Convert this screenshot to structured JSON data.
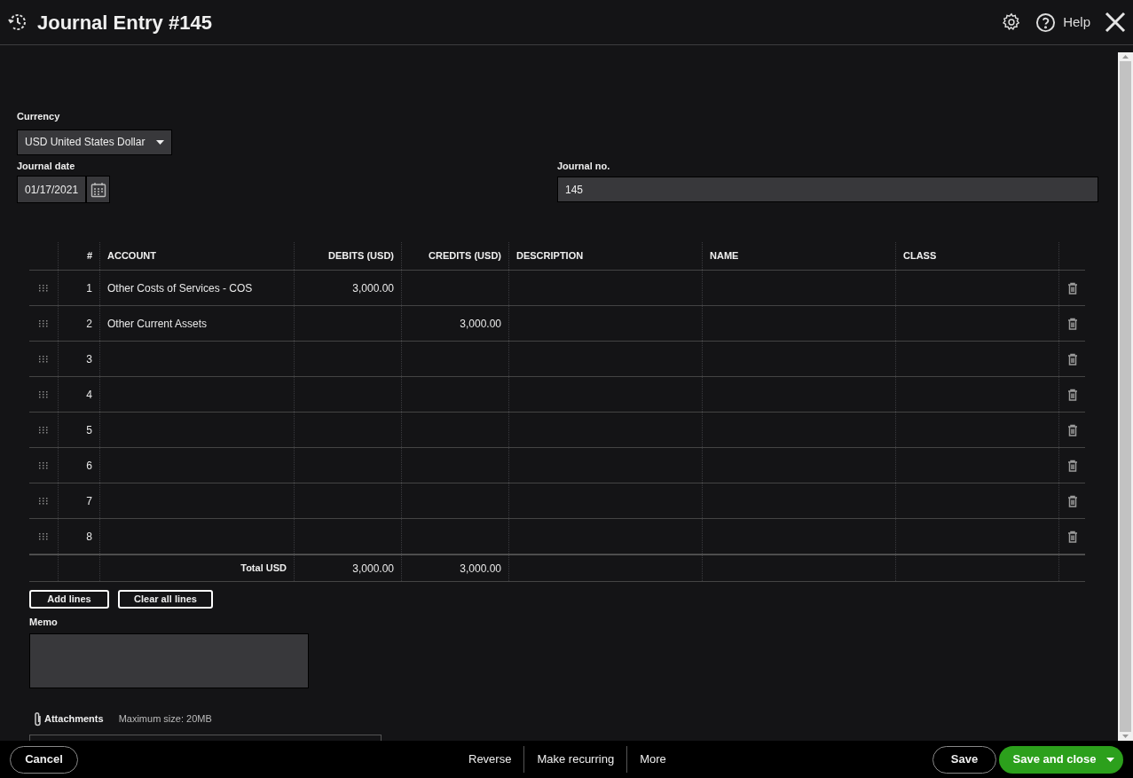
{
  "header": {
    "title": "Journal Entry #145",
    "help": "Help"
  },
  "currency": {
    "label": "Currency",
    "value": "USD United States Dollar"
  },
  "journal_date": {
    "label": "Journal date",
    "value": "01/17/2021"
  },
  "journal_no": {
    "label": "Journal no.",
    "value": "145"
  },
  "table": {
    "columns": [
      "#",
      "ACCOUNT",
      "DEBITS (USD)",
      "CREDITS (USD)",
      "DESCRIPTION",
      "NAME",
      "CLASS"
    ],
    "rows": [
      {
        "number": "1",
        "account": "Other Costs of Services - COS",
        "debits": "3,000.00"
      },
      {
        "number": "2",
        "account": "Other Current Assets",
        "credits": "3,000.00"
      },
      {
        "number": "3"
      },
      {
        "number": "4"
      },
      {
        "number": "5"
      },
      {
        "number": "6"
      },
      {
        "number": "7"
      },
      {
        "number": "8"
      }
    ],
    "total": {
      "label": "Total USD",
      "debits": "3,000.00",
      "credits": "3,000.00"
    }
  },
  "table_buttons": [
    "Add lines",
    "Clear all lines"
  ],
  "memo": {
    "label": "Memo"
  },
  "attachments": {
    "label": "Attachments",
    "note": "Maximum size: 20MB"
  },
  "footer": {
    "cancel": "Cancel",
    "actions": [
      "Reverse",
      "Make recurring",
      "More"
    ],
    "save": "Save",
    "save_and_close": "Save and close"
  }
}
